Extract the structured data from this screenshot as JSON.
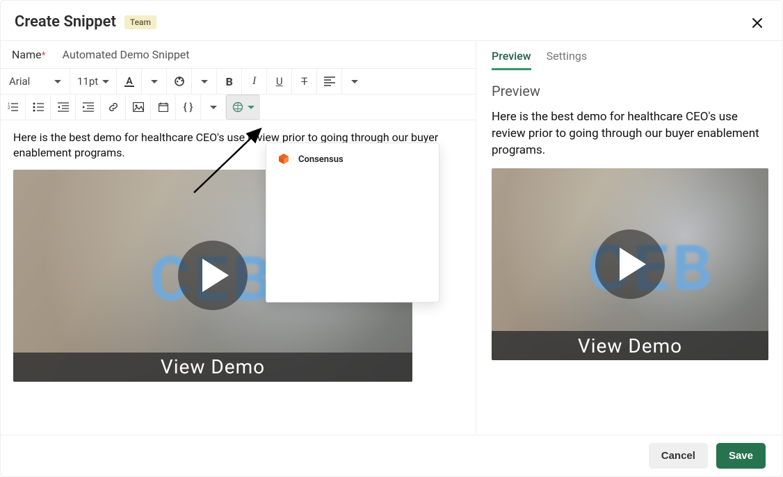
{
  "header": {
    "title": "Create Snippet",
    "badge": "Team"
  },
  "name": {
    "label": "Name",
    "required_marker": "*",
    "value": "Automated Demo Snippet"
  },
  "toolbar": {
    "font_family": "Arial",
    "font_size": "11pt"
  },
  "editor": {
    "body_text": "Here is the best demo for healthcare CEO's use review prior to going through our buyer enablement programs."
  },
  "video": {
    "logo_text": "CEB",
    "caption": "View Demo"
  },
  "dropdown": {
    "items": [
      {
        "label": "Consensus"
      }
    ]
  },
  "preview": {
    "tabs": [
      {
        "label": "Preview",
        "active": true
      },
      {
        "label": "Settings",
        "active": false
      }
    ],
    "heading": "Preview",
    "body_text": "Here is the best demo for healthcare CEO's use review prior to going through our buyer enablement programs."
  },
  "footer": {
    "cancel": "Cancel",
    "save": "Save"
  }
}
